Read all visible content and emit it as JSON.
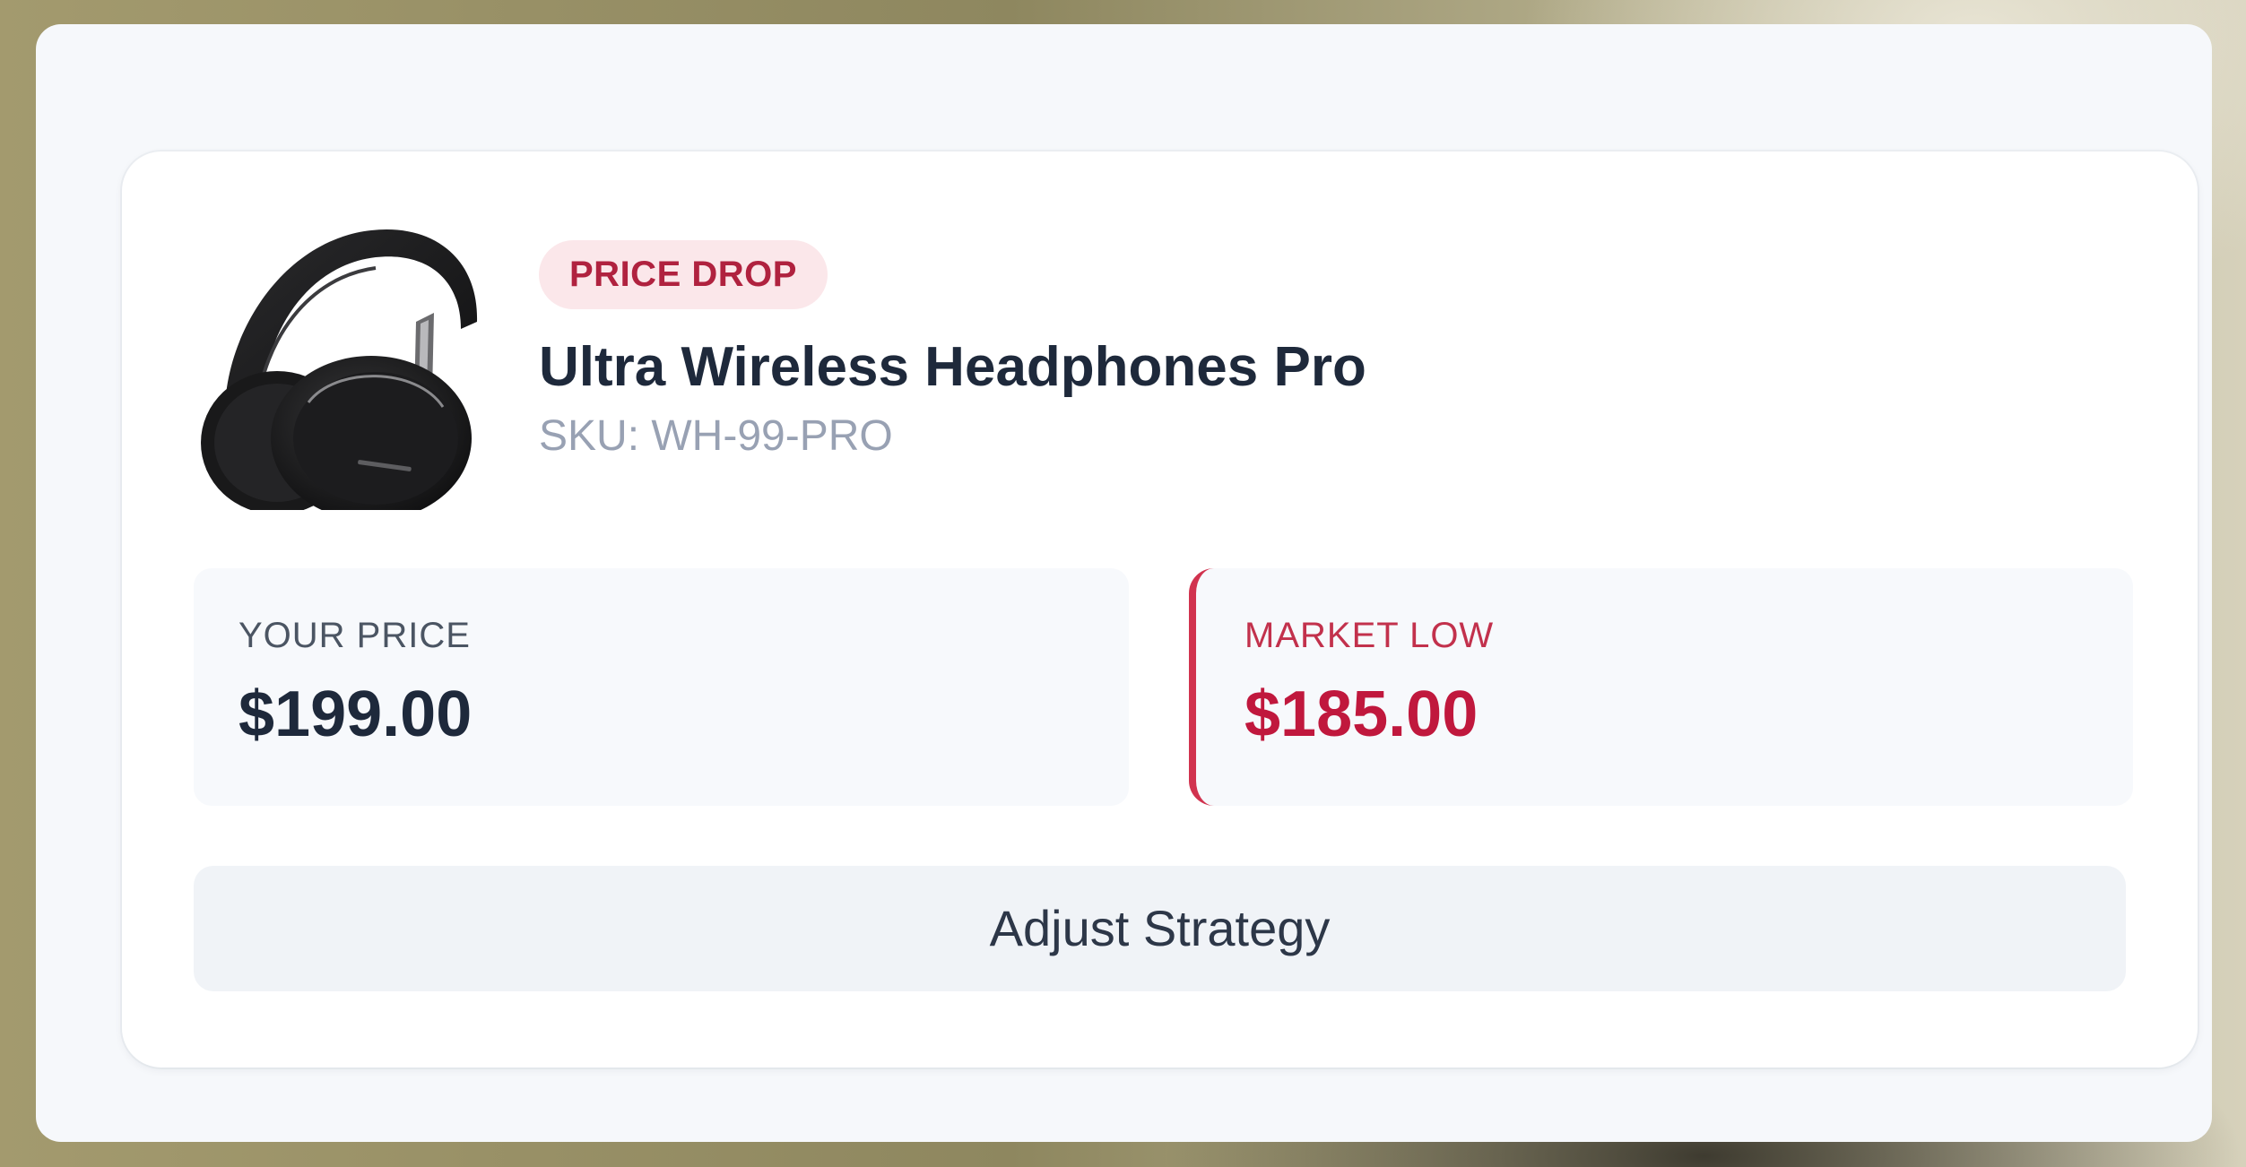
{
  "product": {
    "badge": "PRICE DROP",
    "title": "Ultra Wireless Headphones Pro",
    "sku": "SKU: WH-99-PRO",
    "image_icon": "headphones-image"
  },
  "pricing": {
    "your_price_label": "YOUR PRICE",
    "your_price_value": "$199.00",
    "market_low_label": "MARKET LOW",
    "market_low_value": "$185.00"
  },
  "actions": {
    "adjust_label": "Adjust Strategy"
  },
  "colors": {
    "accent": "#c0183d",
    "badge_bg": "#fbe7ea",
    "text_primary": "#1e293b",
    "text_muted": "#98a1b3"
  }
}
